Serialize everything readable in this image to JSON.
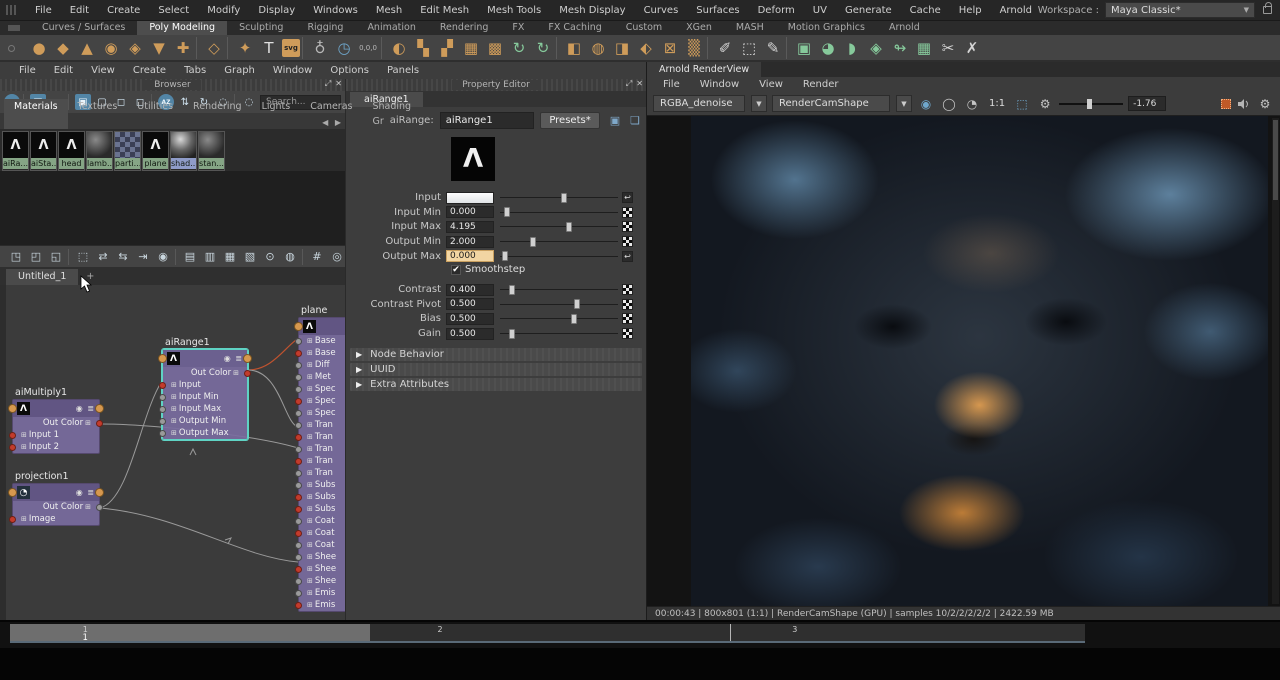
{
  "menubar": {
    "items": [
      "File",
      "Edit",
      "Create",
      "Select",
      "Modify",
      "Display",
      "Windows",
      "Mesh",
      "Edit Mesh",
      "Mesh Tools",
      "Mesh Display",
      "Curves",
      "Surfaces",
      "Deform",
      "UV",
      "Generate",
      "Cache",
      "Help",
      "Arnold"
    ],
    "workspace_label": "Workspace :",
    "workspace_value": "Maya Classic*",
    "workspace_arrow": "▼"
  },
  "shelf": {
    "tabs": [
      {
        "label": "Curves / Surfaces",
        "cls": ""
      },
      {
        "label": "Poly Modeling",
        "cls": "active"
      },
      {
        "label": "Sculpting",
        "cls": ""
      },
      {
        "label": "Rigging",
        "cls": ""
      },
      {
        "label": "Animation",
        "cls": ""
      },
      {
        "label": "Rendering",
        "cls": ""
      },
      {
        "label": "FX",
        "cls": ""
      },
      {
        "label": "FX Caching",
        "cls": ""
      },
      {
        "label": "Custom",
        "cls": ""
      },
      {
        "label": "XGen",
        "cls": ""
      },
      {
        "label": "MASH",
        "cls": ""
      },
      {
        "label": "Motion Graphics",
        "cls": ""
      },
      {
        "label": "Arnold",
        "cls": ""
      }
    ],
    "icons": [
      {
        "glyph": "●",
        "color": "#cf9c5a",
        "cls": ""
      },
      {
        "glyph": "◆",
        "color": "#cf9c5a",
        "cls": ""
      },
      {
        "glyph": "▲",
        "color": "#cf9c5a",
        "cls": ""
      },
      {
        "glyph": "◉",
        "color": "#cf9c5a",
        "cls": ""
      },
      {
        "glyph": "◈",
        "color": "#cf9c5a",
        "cls": ""
      },
      {
        "glyph": "▼",
        "color": "#cf9c5a",
        "cls": ""
      },
      {
        "glyph": "✚",
        "color": "#cf9c5a",
        "cls": ""
      },
      {
        "glyph": "",
        "color": "",
        "cls": "sep"
      },
      {
        "glyph": "◇",
        "color": "#cf9c5a",
        "cls": ""
      },
      {
        "glyph": "",
        "color": "",
        "cls": "sep"
      },
      {
        "glyph": "✦",
        "color": "#cf9c5a",
        "cls": ""
      },
      {
        "glyph": "T",
        "color": "#e0e0e0",
        "cls": ""
      },
      {
        "glyph": "svg",
        "color": "",
        "cls": "badge"
      },
      {
        "glyph": "",
        "color": "",
        "cls": "sep"
      },
      {
        "glyph": "♁",
        "color": "#b8b8b8",
        "cls": ""
      },
      {
        "glyph": "◷",
        "color": "#6fa7cc",
        "cls": ""
      },
      {
        "glyph": "0,0,0",
        "color": "#b8b8b8",
        "cls": "txt"
      },
      {
        "glyph": "",
        "color": "",
        "cls": "sep"
      },
      {
        "glyph": "◐",
        "color": "#cf9c5a",
        "cls": ""
      },
      {
        "glyph": "▚",
        "color": "#cf9c5a",
        "cls": ""
      },
      {
        "glyph": "▞",
        "color": "#cf9c5a",
        "cls": ""
      },
      {
        "glyph": "▦",
        "color": "#cf9c5a",
        "cls": ""
      },
      {
        "glyph": "▩",
        "color": "#cf9c5a",
        "cls": ""
      },
      {
        "glyph": "↻",
        "color": "#86c99b",
        "cls": ""
      },
      {
        "glyph": "↻",
        "color": "#86c99b",
        "cls": ""
      },
      {
        "glyph": "",
        "color": "",
        "cls": "sep"
      },
      {
        "glyph": "◧",
        "color": "#cf9c5a",
        "cls": ""
      },
      {
        "glyph": "◍",
        "color": "#cf9c5a",
        "cls": ""
      },
      {
        "glyph": "◨",
        "color": "#cf9c5a",
        "cls": ""
      },
      {
        "glyph": "⬖",
        "color": "#cf9c5a",
        "cls": ""
      },
      {
        "glyph": "⊠",
        "color": "#cf9c5a",
        "cls": ""
      },
      {
        "glyph": "▒",
        "color": "#cf9c5a",
        "cls": ""
      },
      {
        "glyph": "",
        "color": "",
        "cls": "sep"
      },
      {
        "glyph": "✐",
        "color": "#d5d5d5",
        "cls": ""
      },
      {
        "glyph": "⬚",
        "color": "#d5d5d5",
        "cls": ""
      },
      {
        "glyph": "✎",
        "color": "#d5d5d5",
        "cls": ""
      },
      {
        "glyph": "",
        "color": "",
        "cls": "sep"
      },
      {
        "glyph": "▣",
        "color": "#86c99b",
        "cls": ""
      },
      {
        "glyph": "◕",
        "color": "#86c99b",
        "cls": ""
      },
      {
        "glyph": "◗",
        "color": "#86c99b",
        "cls": ""
      },
      {
        "glyph": "◈",
        "color": "#86c99b",
        "cls": ""
      },
      {
        "glyph": "↬",
        "color": "#86c99b",
        "cls": ""
      },
      {
        "glyph": "▦",
        "color": "#86c99b",
        "cls": ""
      },
      {
        "glyph": "✂",
        "color": "#d5d5d5",
        "cls": ""
      },
      {
        "glyph": "✗",
        "color": "#d5d5d5",
        "cls": ""
      }
    ]
  },
  "hypershade": {
    "menus": [
      "File",
      "Edit",
      "View",
      "Create",
      "Tabs",
      "Graph",
      "Window",
      "Options",
      "Panels"
    ],
    "browser": {
      "title": "Browser",
      "float_icon": "⤢",
      "close_icon": "✕",
      "toolbar_icons": [
        {
          "glyph": "ON",
          "cls": "blue round"
        },
        {
          "glyph": "",
          "cls": "sep"
        },
        {
          "glyph": "▣",
          "cls": "blue"
        },
        {
          "glyph": "—",
          "cls": "plain"
        },
        {
          "glyph": "",
          "cls": "sep"
        },
        {
          "glyph": "▣",
          "cls": "blue"
        },
        {
          "glyph": "▢",
          "cls": "plain"
        },
        {
          "glyph": "◻",
          "cls": "plain"
        },
        {
          "glyph": "◻",
          "cls": "plain"
        },
        {
          "glyph": "",
          "cls": "sep"
        },
        {
          "glyph": "AZ",
          "cls": "blue round"
        },
        {
          "glyph": "⇅",
          "cls": "plain"
        },
        {
          "glyph": "↻",
          "cls": "plain"
        },
        {
          "glyph": "◌",
          "cls": "plain"
        },
        {
          "glyph": "",
          "cls": "sep"
        },
        {
          "glyph": "◌",
          "cls": "plain"
        }
      ],
      "search_placeholder": "Search...",
      "tabs": [
        {
          "label": "Materials",
          "cls": "active"
        },
        {
          "label": "Textures",
          "cls": ""
        },
        {
          "label": "Utilities",
          "cls": ""
        },
        {
          "label": "Rendering",
          "cls": ""
        },
        {
          "label": "Lights",
          "cls": ""
        },
        {
          "label": "Cameras",
          "cls": ""
        },
        {
          "label": "Shading Gr",
          "cls": ""
        }
      ],
      "tab_arrows": "◀ ▶",
      "swatches": [
        {
          "label": "aiRa...",
          "glyph": "Λ",
          "swatch_cls": "sw-arnold",
          "label_cls": ""
        },
        {
          "label": "aiSta...",
          "glyph": "Λ",
          "swatch_cls": "sw-arnold",
          "label_cls": ""
        },
        {
          "label": "head",
          "glyph": "Λ",
          "swatch_cls": "sw-arnold",
          "label_cls": ""
        },
        {
          "label": "lamb...",
          "glyph": "",
          "swatch_cls": "sw-sphere",
          "label_cls": ""
        },
        {
          "label": "parti...",
          "glyph": "",
          "swatch_cls": "sw-checker",
          "label_cls": ""
        },
        {
          "label": "plane",
          "glyph": "Λ",
          "swatch_cls": "sw-arnold",
          "label_cls": ""
        },
        {
          "label": "shad...",
          "glyph": "",
          "swatch_cls": "sw-shiny",
          "label_cls": "selected"
        },
        {
          "label": "stan...",
          "glyph": "",
          "swatch_cls": "sw-sphere",
          "label_cls": ""
        }
      ]
    },
    "node_editor": {
      "icons": [
        {
          "glyph": "◳",
          "cls": ""
        },
        {
          "glyph": "◰",
          "cls": ""
        },
        {
          "glyph": "◱",
          "cls": ""
        },
        {
          "glyph": "",
          "cls": "sep"
        },
        {
          "glyph": "⬚",
          "cls": ""
        },
        {
          "glyph": "⇄",
          "cls": ""
        },
        {
          "glyph": "⇆",
          "cls": ""
        },
        {
          "glyph": "⇥",
          "cls": ""
        },
        {
          "glyph": "◉",
          "cls": ""
        },
        {
          "glyph": "",
          "cls": "sep"
        },
        {
          "glyph": "▤",
          "cls": ""
        },
        {
          "glyph": "▥",
          "cls": ""
        },
        {
          "glyph": "▦",
          "cls": ""
        },
        {
          "glyph": "▧",
          "cls": ""
        },
        {
          "glyph": "⊙",
          "cls": ""
        },
        {
          "glyph": "◍",
          "cls": ""
        },
        {
          "glyph": "",
          "cls": "sep"
        },
        {
          "glyph": "#",
          "cls": ""
        },
        {
          "glyph": "◎",
          "cls": ""
        }
      ],
      "tab": "Untitled_1",
      "add_tab": "+"
    }
  },
  "graph": {
    "aiMultiply1": {
      "title": "aiMultiply1",
      "out": "Out Color",
      "in1": "Input 1",
      "in2": "Input 2"
    },
    "projection1": {
      "title": "projection1",
      "out": "Out Color",
      "in1": "Image"
    },
    "aiRange1": {
      "title": "aiRange1",
      "out": "Out Color",
      "rows": [
        {
          "label": "Input",
          "dot": "red"
        },
        {
          "label": "Input Min",
          "dot": "gray"
        },
        {
          "label": "Input Max",
          "dot": "gray"
        },
        {
          "label": "Output Min",
          "dot": "gray"
        },
        {
          "label": "Output Max",
          "dot": "gray"
        }
      ]
    },
    "plane": {
      "title": "plane",
      "rows": [
        {
          "label": "Base",
          "dot": "gray"
        },
        {
          "label": "Base",
          "dot": "red"
        },
        {
          "label": "Diff",
          "dot": "gray"
        },
        {
          "label": "Met",
          "dot": "gray"
        },
        {
          "label": "Spec",
          "dot": "gray"
        },
        {
          "label": "Spec",
          "dot": "red"
        },
        {
          "label": "Spec",
          "dot": "gray"
        },
        {
          "label": "Tran",
          "dot": "gray"
        },
        {
          "label": "Tran",
          "dot": "red"
        },
        {
          "label": "Tran",
          "dot": "gray"
        },
        {
          "label": "Tran",
          "dot": "red"
        },
        {
          "label": "Tran",
          "dot": "gray"
        },
        {
          "label": "Subs",
          "dot": "gray"
        },
        {
          "label": "Subs",
          "dot": "red"
        },
        {
          "label": "Subs",
          "dot": "red"
        },
        {
          "label": "Coat",
          "dot": "gray"
        },
        {
          "label": "Coat",
          "dot": "red"
        },
        {
          "label": "Coat",
          "dot": "gray"
        },
        {
          "label": "Shee",
          "dot": "gray"
        },
        {
          "label": "Shee",
          "dot": "red"
        },
        {
          "label": "Shee",
          "dot": "gray"
        },
        {
          "label": "Emis",
          "dot": "gray"
        },
        {
          "label": "Emis",
          "dot": "red"
        }
      ]
    }
  },
  "property_editor": {
    "title": "Property Editor",
    "float_icon": "⤢",
    "close_icon": "✕",
    "tab": "aiRange1",
    "name_label": "aiRange:",
    "name_value": "aiRange1",
    "presets_label": "Presets*",
    "logo_glyph": "Λ",
    "rows": [
      {
        "label": "Input",
        "value": "",
        "slider": "52%",
        "icon_cls": "icon-conn",
        "field_cls": "colorfield"
      },
      {
        "label": "Input Min",
        "value": "0.000",
        "slider": "3%",
        "icon_cls": "icon-checker",
        "field_cls": ""
      },
      {
        "label": "Input Max",
        "value": "4.195",
        "slider": "56%",
        "icon_cls": "icon-checker",
        "field_cls": ""
      },
      {
        "label": "Output Min",
        "value": "2.000",
        "slider": "25%",
        "icon_cls": "icon-checker",
        "field_cls": ""
      },
      {
        "label": "Output Max",
        "value": "0.000",
        "slider": "2%",
        "icon_cls": "icon-conn",
        "field_cls": "highlight"
      }
    ],
    "smoothstep_label": "Smoothstep",
    "check_glyph": "✔",
    "rows2": [
      {
        "label": "Contrast",
        "value": "0.400",
        "slider": "8%",
        "icon_cls": "icon-checker",
        "field_cls": ""
      },
      {
        "label": "Contrast Pivot",
        "value": "0.500",
        "slider": "63%",
        "icon_cls": "icon-checker",
        "field_cls": ""
      },
      {
        "label": "Bias",
        "value": "0.500",
        "slider": "60%",
        "icon_cls": "icon-checker",
        "field_cls": ""
      },
      {
        "label": "Gain",
        "value": "0.500",
        "slider": "8%",
        "icon_cls": "icon-checker",
        "field_cls": ""
      }
    ],
    "sections": [
      "Node Behavior",
      "UUID",
      "Extra Attributes"
    ],
    "section_arrow": "▶"
  },
  "renderview": {
    "tab": "Arnold RenderView",
    "menus": [
      "File",
      "Window",
      "View",
      "Render"
    ],
    "aov_value": "RGBA_denoise",
    "camera_value": "RenderCamShape",
    "dd_arrow": "▼",
    "zoom_label": "1:1",
    "exposure_value": "-1.76",
    "status": "00:00:43 | 800x801 (1:1) | RenderCamShape  (GPU) | samples 10/2/2/2/2/2 | 2422.59 MB"
  },
  "timeline": {
    "ticks": [
      {
        "label": "1",
        "pos": "7%"
      },
      {
        "label": "2",
        "pos": "40%"
      },
      {
        "label": "3",
        "pos": "73%"
      }
    ],
    "current_frame": "1"
  }
}
